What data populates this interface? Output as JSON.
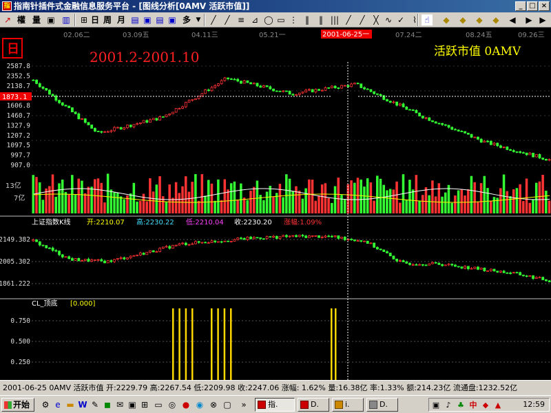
{
  "window": {
    "title": "指南针插件式金融信息服务平台 - [图线分析[0AMV 活跃市值]]",
    "app_icon": "app-icon",
    "controls": [
      "_",
      "□",
      "×"
    ]
  },
  "toolbar": {
    "period_labels": [
      "日",
      "周",
      "月"
    ],
    "multi_label": "多",
    "items": [
      "權",
      "量"
    ]
  },
  "chart": {
    "period_badge": "日",
    "overlay_range": "2001.2-2001.10",
    "overlay_name": "活跃市值 0AMV",
    "date_labels": [
      "02.06二",
      "03.09五",
      "04.11三",
      "05.21一",
      "07.24二",
      "08.24五",
      "09.26三"
    ],
    "cursor_date": "2001-06-25一",
    "price_axis": [
      "2587.8",
      "2352.5",
      "2138.7",
      "1873.1",
      "1606.8",
      "1460.7",
      "1327.9",
      "1207.2",
      "1097.5",
      "997.7",
      "907.0"
    ],
    "cursor_value": "1873.1",
    "volume_axis": [
      "13亿",
      "7亿"
    ],
    "index_panel": {
      "name": "上证指数K线",
      "open_label": "开:2210.07",
      "high_label": "高:2230.22",
      "low_label": "低:2210.04",
      "close_label": "收:2230.20",
      "change_label": "涨幅:1.09%",
      "axis": [
        "2149.382",
        "2005.302",
        "1861.222"
      ]
    },
    "cl_panel": {
      "name": "CL_顶底",
      "value": "[0.000]",
      "axis": [
        "0.750",
        "0.500",
        "0.250"
      ]
    },
    "colors": {
      "up": "#ff3333",
      "down": "#33ff33",
      "ma": "#ffffff",
      "cursor": "#ffffff",
      "overlay_red": "#ff2020",
      "overlay_yellow": "#ffff00",
      "cl_bars": "#ffd700"
    }
  },
  "chart_data": [
    {
      "type": "line",
      "title": "活跃市值 0AMV",
      "x_labels": [
        "02.06二",
        "03.09五",
        "04.11三",
        "05.21一",
        "06.25一",
        "07.24二",
        "08.24五",
        "09.26三"
      ],
      "values": [
        2352,
        1450,
        1720,
        2380,
        2120,
        2280,
        1750,
        1300,
        1000
      ],
      "ylim": [
        907.0,
        2587.8
      ]
    },
    {
      "type": "bar",
      "title": "成交量",
      "ylabels": [
        "13亿",
        "7亿"
      ]
    },
    {
      "type": "line",
      "title": "上证指数K线",
      "ylim": [
        1861.222,
        2149.382
      ],
      "values": [
        2140,
        2020,
        2005,
        2060,
        2120,
        2140,
        2160,
        2170,
        2170,
        2140,
        1995,
        1990,
        1960,
        1930,
        1880
      ]
    },
    {
      "type": "bar",
      "title": "CL_顶底",
      "ylim": [
        0,
        1
      ],
      "highlighted_bands": 3
    }
  ],
  "status": {
    "text": "2001-06-25 0AMV 活跃市值 开:2229.79 高:2267.54 低:2209.98 收:2247.06 涨幅: 1.62% 量:16.38亿 率:1.33% 额:214.23亿 流通盘:1232.52亿"
  },
  "taskbar": {
    "start_label": "开始",
    "tasks": [
      "指.",
      "D.",
      "i.",
      "D."
    ],
    "clock": "12:59",
    "ime": "中"
  }
}
